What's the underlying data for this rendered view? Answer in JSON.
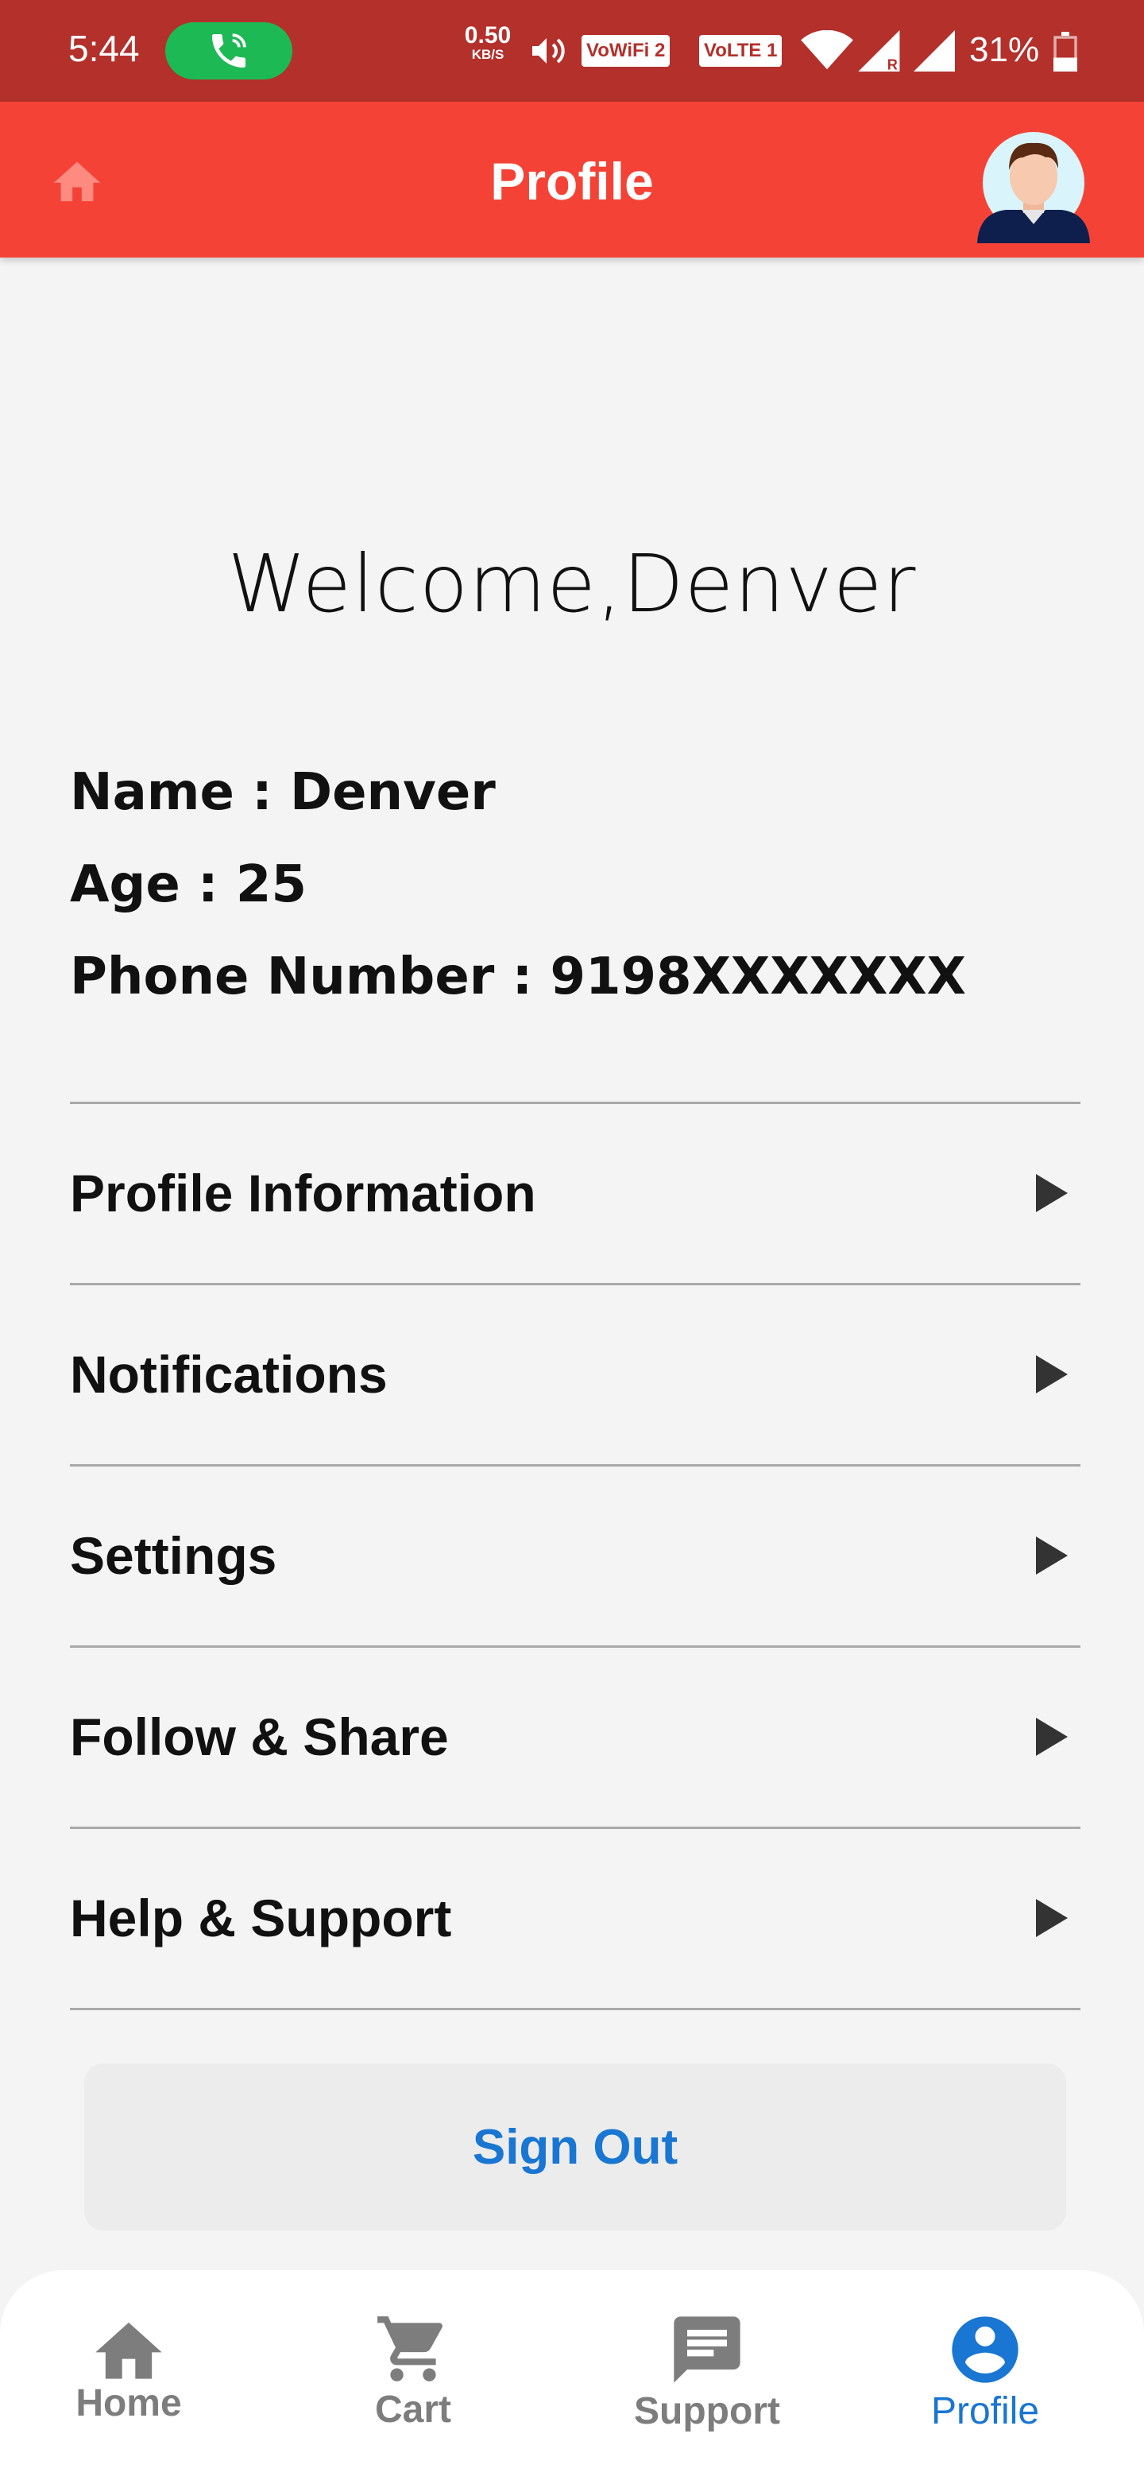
{
  "status_bar": {
    "time": "5:44",
    "net_speed_value": "0.50",
    "net_speed_unit": "KB/S",
    "badge_wifi": "VoWiFi 2",
    "badge_lte": "VoLTE 1",
    "battery": "31%"
  },
  "app_bar": {
    "title": "Profile",
    "home_icon": "home-icon",
    "avatar_icon": "user-avatar"
  },
  "welcome": "Welcome,Denver",
  "info": {
    "name": "Name : Denver",
    "age": "Age : 25",
    "phone": "Phone Number : 9198XXXXXXX"
  },
  "menu": [
    {
      "label": "Profile Information"
    },
    {
      "label": "Notifications"
    },
    {
      "label": "Settings"
    },
    {
      "label": "Follow & Share"
    },
    {
      "label": "Help & Support"
    }
  ],
  "sign_out": "Sign Out",
  "bottom_nav": {
    "items": [
      {
        "label": "Home",
        "icon": "home-icon",
        "active": false
      },
      {
        "label": "Cart",
        "icon": "cart-icon",
        "active": false
      },
      {
        "label": "Support",
        "icon": "chat-icon",
        "active": false
      },
      {
        "label": "Profile",
        "icon": "account-circle-icon",
        "active": true
      }
    ]
  },
  "colors": {
    "status_bar": "#b3302b",
    "app_bar": "#f44336",
    "accent": "#1976d2",
    "call_pill": "#1db954"
  }
}
